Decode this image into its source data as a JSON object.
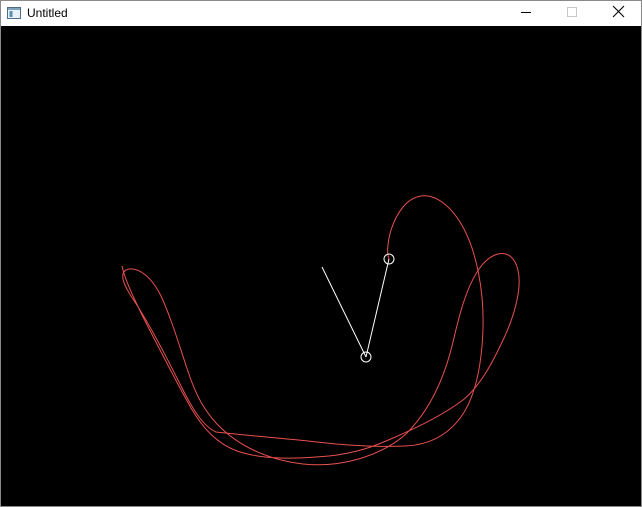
{
  "window": {
    "title": "Untitled",
    "icon": "app-window-icon",
    "controls": {
      "minimize_icon": "minimize-icon",
      "maximize_icon": "maximize-icon",
      "close_icon": "close-icon"
    }
  },
  "scene": {
    "background_color": "#000000",
    "arm_color": "#ffffff",
    "trace_color": "#e8504f",
    "joint_color": "#ffffff"
  }
}
